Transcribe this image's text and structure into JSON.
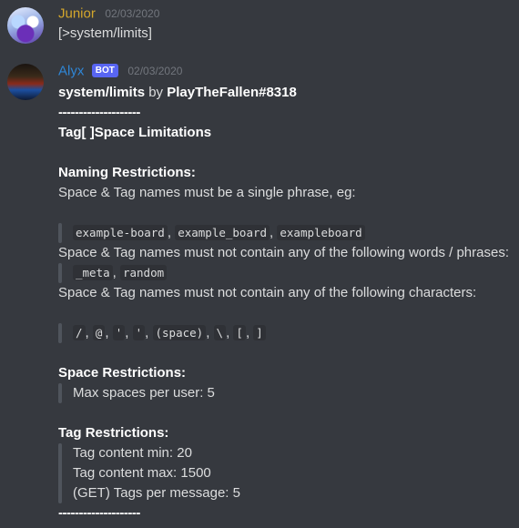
{
  "messages": [
    {
      "username": "Junior",
      "timestamp": "02/03/2020",
      "text": "[>system/limits]"
    },
    {
      "username": "Alyx",
      "bot_tag": "BOT",
      "timestamp": "02/03/2020",
      "title_cmd": "system/limits",
      "title_by": " by ",
      "title_author": "PlayTheFallen#8318",
      "separator": "--------------------",
      "heading": "Tag[ ]Space Limitations",
      "naming": {
        "heading": "Naming Restrictions:",
        "line1": "Space & Tag names must be a single phrase, eg:",
        "examples": [
          "example-board",
          "example_board",
          "exampleboard"
        ],
        "line2": "Space & Tag names must not contain any of the following words / phrases:",
        "words": [
          "_meta",
          "random"
        ],
        "line3": "Space & Tag names must not contain any of the following characters:",
        "chars": [
          "/",
          "@",
          "'",
          "'",
          "(space)",
          "\\",
          "[",
          "]"
        ]
      },
      "space": {
        "heading": "Space Restrictions:",
        "max_spaces": "Max spaces per user: 5"
      },
      "tag": {
        "heading": "Tag Restrictions:",
        "min": "Tag content min: 20",
        "max": "Tag content max: 1500",
        "get": "(GET) Tags per message: 5"
      },
      "footer_separator": "--------------------"
    }
  ]
}
